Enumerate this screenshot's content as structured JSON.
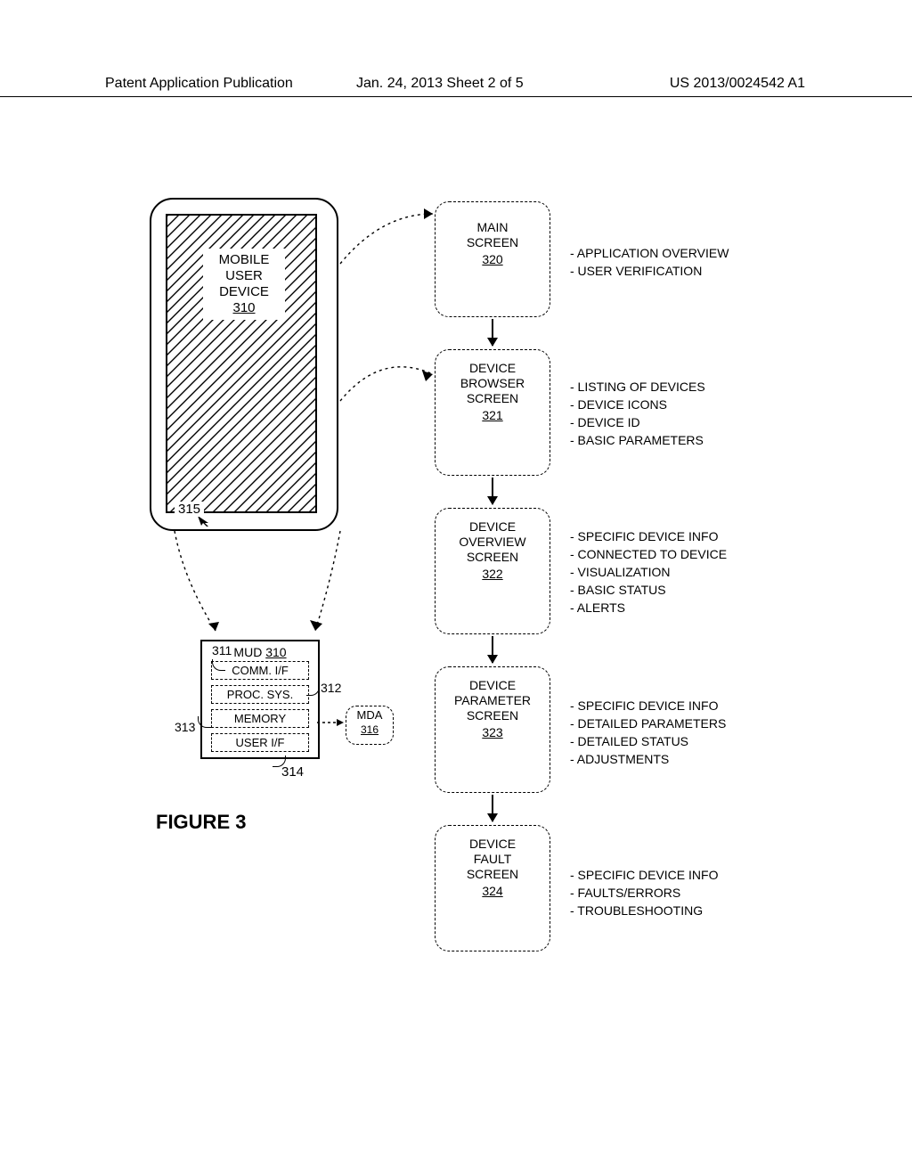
{
  "header": {
    "left": "Patent Application Publication",
    "mid": "Jan. 24, 2013  Sheet 2 of 5",
    "right": "US 2013/0024542 A1"
  },
  "figure": {
    "title": "FIGURE 3"
  },
  "mobile": {
    "label_l1": "MOBILE",
    "label_l2": "USER",
    "label_l3": "DEVICE",
    "ref": "310",
    "pointer_ref": "315"
  },
  "mud": {
    "title": "MUD",
    "ref": "310",
    "rows": {
      "r1": {
        "text": "COMM. I/F",
        "num": "311"
      },
      "r2": {
        "text": "PROC. SYS.",
        "num": "312"
      },
      "r3": {
        "text": "MEMORY",
        "num": "313"
      },
      "r4": {
        "text": "USER I/F",
        "num": "314"
      }
    }
  },
  "mda": {
    "label": "MDA",
    "ref": "316"
  },
  "screens": {
    "s1": {
      "l1": "MAIN",
      "l2": "SCREEN",
      "ref": "320"
    },
    "s2": {
      "l1": "DEVICE",
      "l2": "BROWSER",
      "l3": "SCREEN",
      "ref": "321"
    },
    "s3": {
      "l1": "DEVICE",
      "l2": "OVERVIEW",
      "l3": "SCREEN",
      "ref": "322"
    },
    "s4": {
      "l1": "DEVICE",
      "l2": "PARAMETER",
      "l3": "SCREEN",
      "ref": "323"
    },
    "s5": {
      "l1": "DEVICE",
      "l2": "FAULT",
      "l3": "SCREEN",
      "ref": "324"
    }
  },
  "notes": {
    "n1a": "- APPLICATION OVERVIEW",
    "n1b": "- USER VERIFICATION",
    "n2a": "- LISTING OF DEVICES",
    "n2b": "- DEVICE ICONS",
    "n2c": "- DEVICE ID",
    "n2d": "- BASIC PARAMETERS",
    "n3a": "- SPECIFIC DEVICE INFO",
    "n3b": "- CONNECTED TO DEVICE",
    "n3c": "- VISUALIZATION",
    "n3d": "- BASIC STATUS",
    "n3e": "- ALERTS",
    "n4a": "- SPECIFIC DEVICE INFO",
    "n4b": "- DETAILED PARAMETERS",
    "n4c": "- DETAILED STATUS",
    "n4d": "- ADJUSTMENTS",
    "n5a": "- SPECIFIC DEVICE INFO",
    "n5b": "- FAULTS/ERRORS",
    "n5c": "- TROUBLESHOOTING"
  }
}
